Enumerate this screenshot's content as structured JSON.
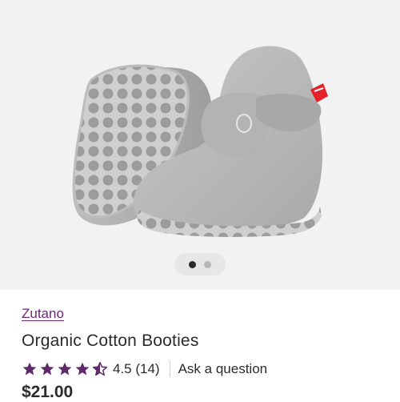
{
  "product": {
    "brand": "Zutano",
    "name": "Organic Cotton Booties",
    "rating_value": 4.5,
    "rating_text": "4.5 (14)",
    "ask_question": "Ask a question",
    "price": "$21.00"
  },
  "carousel": {
    "total_slides": 2,
    "active_index": 0
  },
  "colors": {
    "brand_link": "#6a2a72",
    "star_fill": "#5e2a6b",
    "image_background": "#f2f2f2"
  },
  "icons": {
    "star": "star-icon",
    "half_star": "star-half-icon"
  }
}
